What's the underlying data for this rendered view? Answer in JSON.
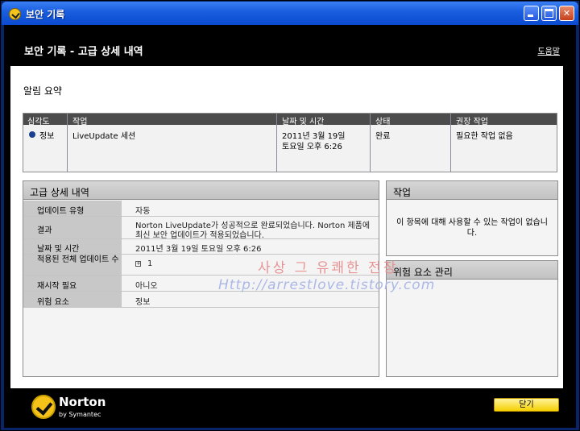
{
  "window": {
    "title": "보안 기록",
    "minimize_icon": "minimize-icon",
    "maximize_icon": "maximize-icon",
    "close_icon": "close-icon"
  },
  "header": {
    "title": "보안 기록 - 고급 상세 내역",
    "help_link": "도움말"
  },
  "summary": {
    "section_title": "알림 요약",
    "columns": [
      "심각도",
      "작업",
      "날짜 및 시간",
      "상태",
      "권장 작업"
    ],
    "row": {
      "severity": "정보",
      "severity_color": "#1d3f8f",
      "task": "LiveUpdate 세션",
      "date_line1": "2011년 3월 19일",
      "date_line2": "토요일 오후 6:26",
      "status": "완료",
      "recommended": "필요한 작업 없음"
    }
  },
  "details": {
    "title": "고급 상세 내역",
    "rows": [
      {
        "label": "업데이트 유형",
        "value": "자동"
      },
      {
        "label": "결과",
        "value": "Norton LiveUpdate가 성공적으로 완료되었습니다. Norton 제품에",
        "value2": "최신 보안 업데이트가 적용되었습니다."
      },
      {
        "label": "날짜 및 시간",
        "value": "2011년 3월 19일 토요일 오후 6:26"
      },
      {
        "label": "적용된 전체 업데이트 수",
        "value": "1"
      },
      {
        "label": "재시작 필요",
        "value": "아니오"
      },
      {
        "label": "위험 요소",
        "value": "정보"
      }
    ]
  },
  "action_panel": {
    "title": "작업",
    "text": "이 항목에 대해 사용할 수 있는 작업이 없습니다."
  },
  "risk_panel": {
    "title": "위험 요소 관리"
  },
  "watermark": {
    "line1": "사상 그 유쾌한 전장",
    "line2": "Http://arrestlove.tistory.com"
  },
  "footer": {
    "brand": "Norton",
    "sub": "by Symantec",
    "close_button": "닫기",
    "accent": "#f5c21a"
  }
}
